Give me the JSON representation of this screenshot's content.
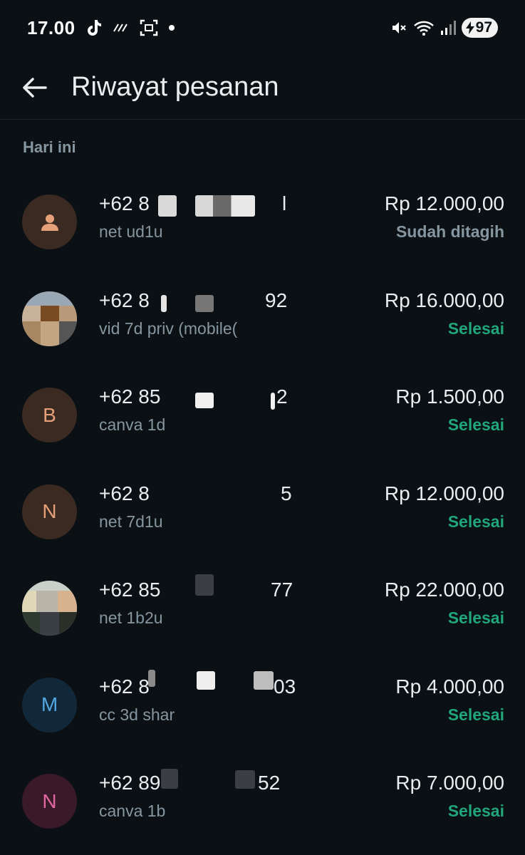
{
  "status_bar": {
    "time": "17.00",
    "battery": "97"
  },
  "header": {
    "title": "Riwayat pesanan"
  },
  "section": {
    "label": "Hari ini"
  },
  "colors": {
    "background": "#0b1014",
    "status_billed": "#8696a0",
    "status_done": "#21a67a"
  },
  "orders": [
    {
      "phone": "+62 8",
      "phone_tail": "l",
      "product": "net ud1u",
      "amount": "Rp 12.000,00",
      "status": "Sudah ditagih",
      "avatar": "person-icon"
    },
    {
      "phone": "+62 8",
      "phone_tail": "92",
      "product": "vid 7d priv (mobile(",
      "amount": "Rp 16.000,00",
      "status": "Selesai",
      "avatar": "photo"
    },
    {
      "phone": "+62 85",
      "phone_tail": "2",
      "product": "canva 1d",
      "amount": "Rp 1.500,00",
      "status": "Selesai",
      "avatar": "B"
    },
    {
      "phone": "+62 8",
      "phone_tail": "5",
      "product": "net 7d1u",
      "amount": "Rp 12.000,00",
      "status": "Selesai",
      "avatar": "N"
    },
    {
      "phone": "+62 85",
      "phone_tail": "77",
      "product": "net 1b2u",
      "amount": "Rp 22.000,00",
      "status": "Selesai",
      "avatar": "photo"
    },
    {
      "phone": "+62 8",
      "phone_tail": "03",
      "product": "cc 3d shar",
      "amount": "Rp 4.000,00",
      "status": "Selesai",
      "avatar": "M"
    },
    {
      "phone": "+62 89",
      "phone_tail": "52",
      "product": "canva 1b",
      "amount": "Rp 7.000,00",
      "status": "Selesai",
      "avatar": "N"
    }
  ]
}
